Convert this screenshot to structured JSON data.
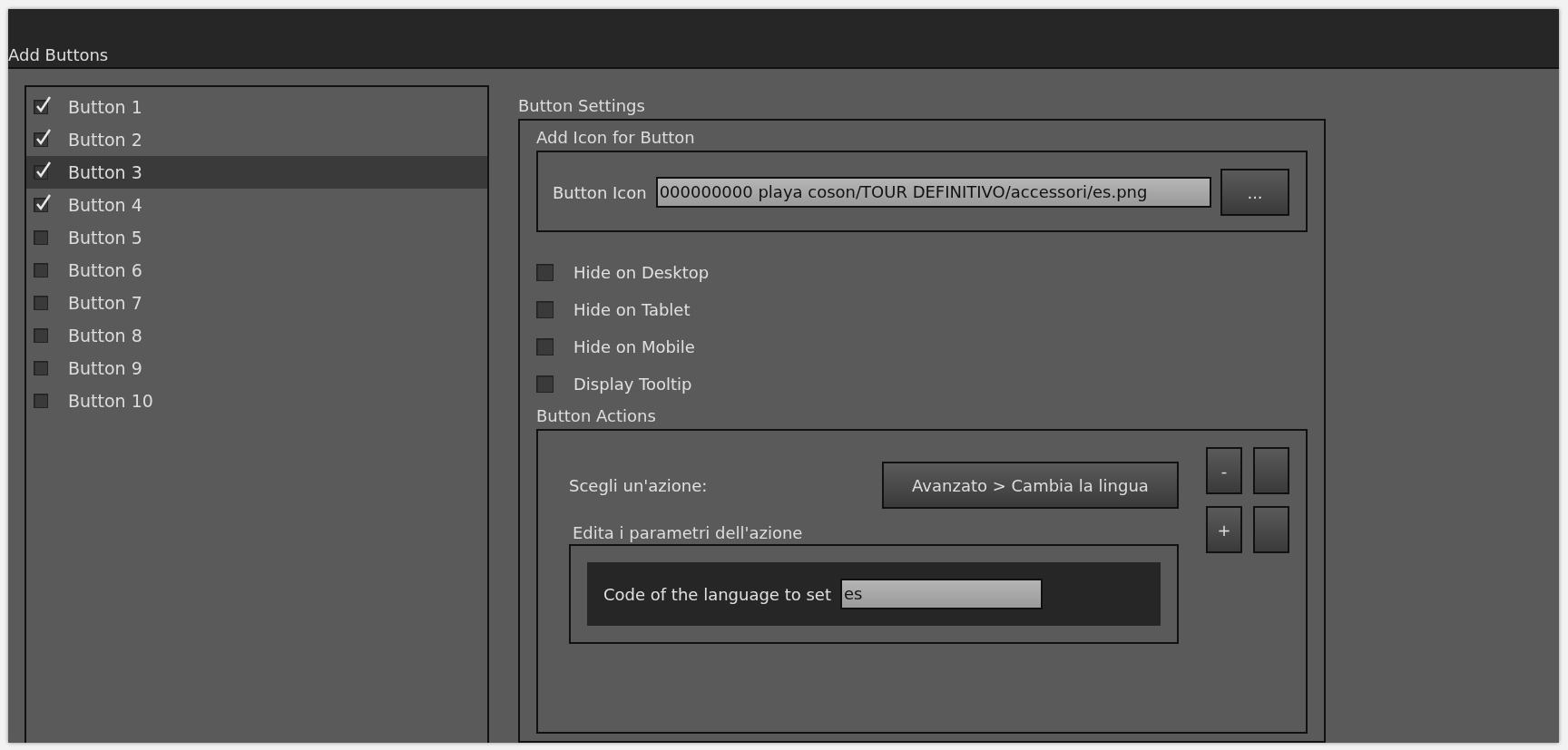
{
  "panel": {
    "title": "Add Buttons"
  },
  "buttons_list": [
    {
      "label": "Button 1",
      "checked": true,
      "selected": false
    },
    {
      "label": "Button 2",
      "checked": true,
      "selected": false
    },
    {
      "label": "Button 3",
      "checked": true,
      "selected": true
    },
    {
      "label": "Button 4",
      "checked": true,
      "selected": false
    },
    {
      "label": "Button 5",
      "checked": false,
      "selected": false
    },
    {
      "label": "Button 6",
      "checked": false,
      "selected": false
    },
    {
      "label": "Button 7",
      "checked": false,
      "selected": false
    },
    {
      "label": "Button 8",
      "checked": false,
      "selected": false
    },
    {
      "label": "Button 9",
      "checked": false,
      "selected": false
    },
    {
      "label": "Button 10",
      "checked": false,
      "selected": false
    }
  ],
  "settings": {
    "title": "Button Settings",
    "icon_group": {
      "title": "Add Icon for Button",
      "label": "Button Icon",
      "value": "000000000 playa coson/TOUR DEFINITIVO/accessori/es.png",
      "browse_button": "..."
    },
    "options": [
      {
        "label": "Hide on Desktop",
        "checked": false
      },
      {
        "label": "Hide on Tablet",
        "checked": false
      },
      {
        "label": "Hide on Mobile",
        "checked": false
      },
      {
        "label": "Display Tooltip",
        "checked": false
      }
    ],
    "actions": {
      "title": "Button Actions",
      "choose_label": "Scegli un'azione:",
      "action_button": "Avanzato > Cambia la lingua",
      "side_buttons": [
        "-",
        "+"
      ],
      "params": {
        "title": "Edita i parametri dell'azione",
        "fields": [
          {
            "label": "Code of the language to set",
            "value": "es"
          }
        ]
      }
    }
  }
}
